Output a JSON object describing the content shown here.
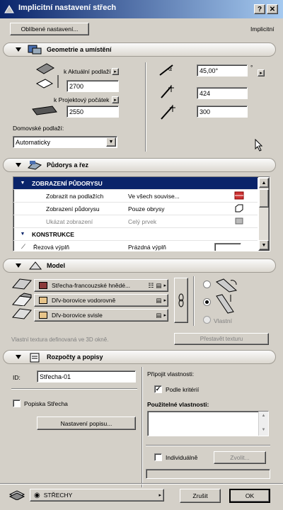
{
  "window": {
    "title": "Implicitní nastavení střech"
  },
  "top": {
    "favorites_label": "Oblíbené nastavení...",
    "default_label": "Implicitní"
  },
  "geometry": {
    "title": "Geometrie a umístění",
    "current_floor_label": "k Aktuální podlaží",
    "current_floor_value": "2700",
    "project_zero_label": "k Projektový počátek",
    "project_zero_value": "2550",
    "home_story_label": "Domovské podlaží:",
    "home_story_value": "Automaticky",
    "angle_value": "45,00°",
    "angle_unit": "°",
    "thickness_value": "424",
    "height_value": "300"
  },
  "floorplan": {
    "title": "Půdorys a řez",
    "group1": "ZOBRAZENÍ PŮDORYSU",
    "rows": [
      {
        "label": "Zobrazit na podlažích",
        "value": "Ve všech souvise..."
      },
      {
        "label": "Zobrazení půdorysu",
        "value": "Pouze obrysy"
      },
      {
        "label": "Ukázat zobrazení",
        "value": "Celý prvek"
      }
    ],
    "group2": "KONSTRUKCE",
    "cut_fill_label": "Řezová výplň",
    "cut_fill_value": "Prázdná výplň"
  },
  "model": {
    "title": "Model",
    "materials": [
      {
        "name": "Střecha-francouzské hnědé...",
        "color": "#8b3a3a"
      },
      {
        "name": "Dřv-borovice vodorovně",
        "color": "#e7c489"
      },
      {
        "name": "Dřv-borovice svisle",
        "color": "#e7c489"
      }
    ],
    "vertical_label": "Vlastní",
    "texture_note": "Vlastní textura definovaná ve 3D okně.",
    "texture_button": "Přestavět texturu"
  },
  "listing": {
    "title": "Rozpočty a popisy",
    "id_label": "ID:",
    "id_value": "Střecha-01",
    "label_checkbox": "Popiska Střecha",
    "label_settings_button": "Nastavení popisu...",
    "attach_label": "Připojit vlastnosti:",
    "criteria_checkbox": "Podle kritérií",
    "available_label": "Použitelné vlastnosti:",
    "individual_checkbox": "Individuálně",
    "select_button": "Zvolit..."
  },
  "footer": {
    "layer_value": "STŘECHY",
    "cancel": "Zrušit",
    "ok": "OK"
  }
}
